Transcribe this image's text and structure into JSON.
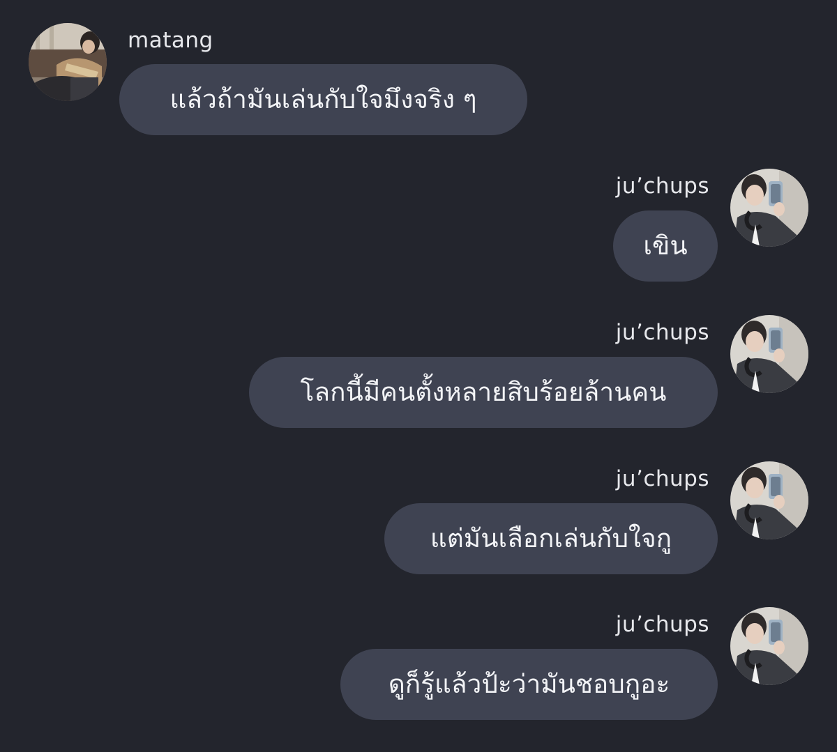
{
  "messages": [
    {
      "sender": "matang",
      "text": "แล้วถ้ามันเล่นกับใจมึงจริง ๆ",
      "side": "left"
    },
    {
      "sender": "ju’chups",
      "text": "เขิน",
      "side": "right"
    },
    {
      "sender": "ju’chups",
      "text": "โลกนี้มีคนตั้งหลายสิบร้อยล้านคน",
      "side": "right"
    },
    {
      "sender": "ju’chups",
      "text": "แต่มันเลือกเล่นกับใจกู",
      "side": "right"
    },
    {
      "sender": "ju’chups",
      "text": "ดูก็รู้แล้วป้ะว่ามันชอบกูอะ",
      "side": "right"
    }
  ],
  "colors": {
    "background": "#23252d",
    "bubble": "#3f4352",
    "text": "#f2f3f6",
    "sender_text": "#e7e8ec"
  }
}
